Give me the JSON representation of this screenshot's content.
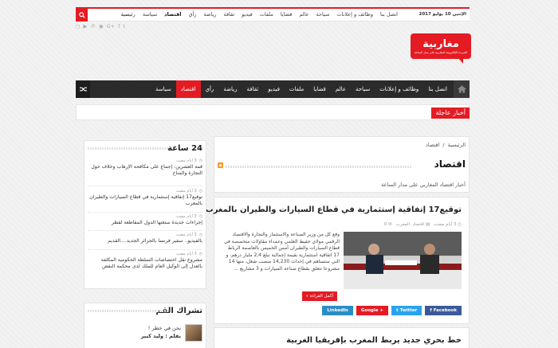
{
  "topbar": {
    "date": "الإثنين 10 يوليو 2017",
    "search_placeholder": "بحث",
    "nav": [
      "رئيسية",
      "سياسة",
      "اقتصاد",
      "رأي",
      "رياضة",
      "ثقافة",
      "فيديو",
      "ملفات",
      "قضايا",
      "عالم",
      "سياحة",
      "وظائف و إعلانات",
      "اتصل بنا"
    ],
    "active": "اقتصاد"
  },
  "social_icons": [
    "instagram-icon",
    "youtube-icon",
    "pinterest-icon",
    "rss-icon",
    "google-plus-icon",
    "facebook-icon",
    "twitter-icon"
  ],
  "logo": {
    "text": "مغاربية",
    "tagline": "الجريدة الإلكترونية المغاربية على مدار الساعة"
  },
  "mainnav": {
    "items": [
      "سياسة",
      "اقتصاد",
      "رأي",
      "رياضة",
      "ثقافة",
      "فيديو",
      "ملفات",
      "قضايا",
      "عالم",
      "سياحة",
      "وظائف و إعلانات",
      "اتصل بنا"
    ],
    "active": "اقتصاد"
  },
  "breaking": {
    "label": "أخبار عاجلة"
  },
  "breadcrumb": {
    "home": "الرئيسية",
    "sep": "/",
    "current": "اقتصاد"
  },
  "category": {
    "title": "اقتصاد",
    "description": "أخبار اقتصاد المغاربي على مدار الساعة"
  },
  "article": {
    "title": "توقيع17 إتفاقية إستثمارية في قطاع السيارات والطيران بالمغرب",
    "time": "3 أيام مضت",
    "category": "اقتصاد, المغرب",
    "comments": "0",
    "excerpt": "وقع كل من وزير الصناعة والاستثمار والتجارة والاقتصاد الرقمي مولاي حفيظ العلمي وعمداء مقاولات متخصصة في قطاع السيارات والطيران أمس الخميس بالعاصمة الرباط 17 اتفاقية استثمارية بقيمة إجمالية تبلغ 2,4 مليار درهم، و التي ستساهم في إحداث 14,230 منصب شغل، منها 14 مشروعا تتعلق بقطاع صناعة السيارات و 3 مشاريع ...",
    "read_more": "أكمل القراءة »",
    "share": {
      "facebook": "Facebook",
      "twitter": "Twitter",
      "google": "Google +",
      "linkedin": "LinkedIn"
    }
  },
  "article2": {
    "title": "خط بحري جديد يربط المغرب بإفريقيا الغربية"
  },
  "sidebar": {
    "recent_title": "24 ساعة",
    "items": [
      {
        "time": "3 أيام مضت",
        "text": "قمة العشرين: إجماع على مكافحة الإرهاب وخلاف حول التجارة والمناخ"
      },
      {
        "time": "3 أيام مضت",
        "text": "توقيع17 إتفاقية إستثمارية في قطاع السيارات والطيران بالمغرب"
      },
      {
        "time": "3 أيام مضت",
        "text": "إجراءات جديدة ستعتها الدول المقاطعة لقطر"
      },
      {
        "time": "3 أيام مضت",
        "text": "بالفيديو.. سفير فرنسا بالجزائر الجديد....القديم"
      },
      {
        "time": "3 أيام مضت",
        "text": "مشروع نقل اختصاصات السلطة الحكومية المكلفة بالعدل إلى الوكيل العام للملك لدى محكمة النقض"
      }
    ],
    "opinion_title": "تشراك القم",
    "author": {
      "headline": "نحن في خطر !",
      "byline": "بقلم : وليد كبير"
    }
  }
}
